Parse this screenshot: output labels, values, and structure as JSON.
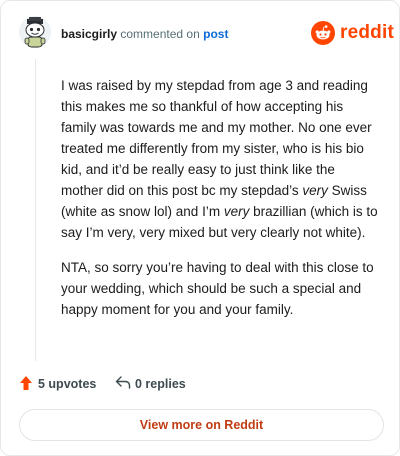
{
  "header": {
    "username": "basicgirly",
    "action_text": "commented on",
    "post_link": "post",
    "brand_word": "reddit",
    "brand_color": "#ff4500"
  },
  "avatar": {
    "icon": "snoo-avatar-icon"
  },
  "comment": {
    "paragraphs": [
      [
        {
          "text": "I was raised by my stepdad from age 3 and reading this makes me so thankful of how accepting his family was towards me and my mother. No one ever treated me differently from my sister, who is his bio kid, and it’d be really easy to just think like the mother did on this post bc my stepdad’s ",
          "em": false
        },
        {
          "text": "very",
          "em": true
        },
        {
          "text": " Swiss (white as snow lol) and I’m ",
          "em": false
        },
        {
          "text": "very",
          "em": true
        },
        {
          "text": " brazillian (which is to say I’m very, very mixed but very clearly not white).",
          "em": false
        }
      ],
      [
        {
          "text": "NTA, so sorry you’re having to deal with this close to your wedding, which should be such a special and happy moment for you and your family.",
          "em": false
        }
      ]
    ]
  },
  "actions": {
    "upvotes_label": "5 upvotes",
    "replies_label": "0 replies",
    "upvote_icon": "upvote-arrow-icon",
    "reply_icon": "reply-arrow-icon",
    "upvote_color": "#ff4500"
  },
  "footer": {
    "view_more_label": "View more on Reddit"
  }
}
